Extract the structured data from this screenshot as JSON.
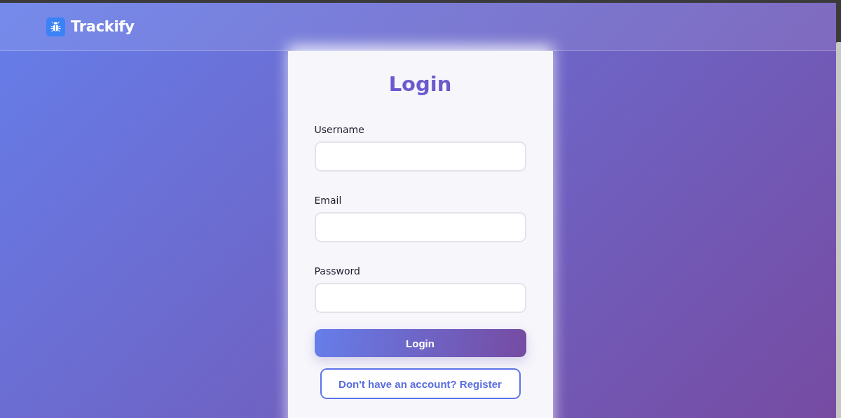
{
  "header": {
    "brand": "Trackify"
  },
  "login_card": {
    "title": "Login",
    "fields": [
      {
        "label": "Username"
      },
      {
        "label": "Email"
      },
      {
        "label": "Password"
      }
    ],
    "submit_button": "Login",
    "register_link": "Don't have an account? Register"
  }
}
